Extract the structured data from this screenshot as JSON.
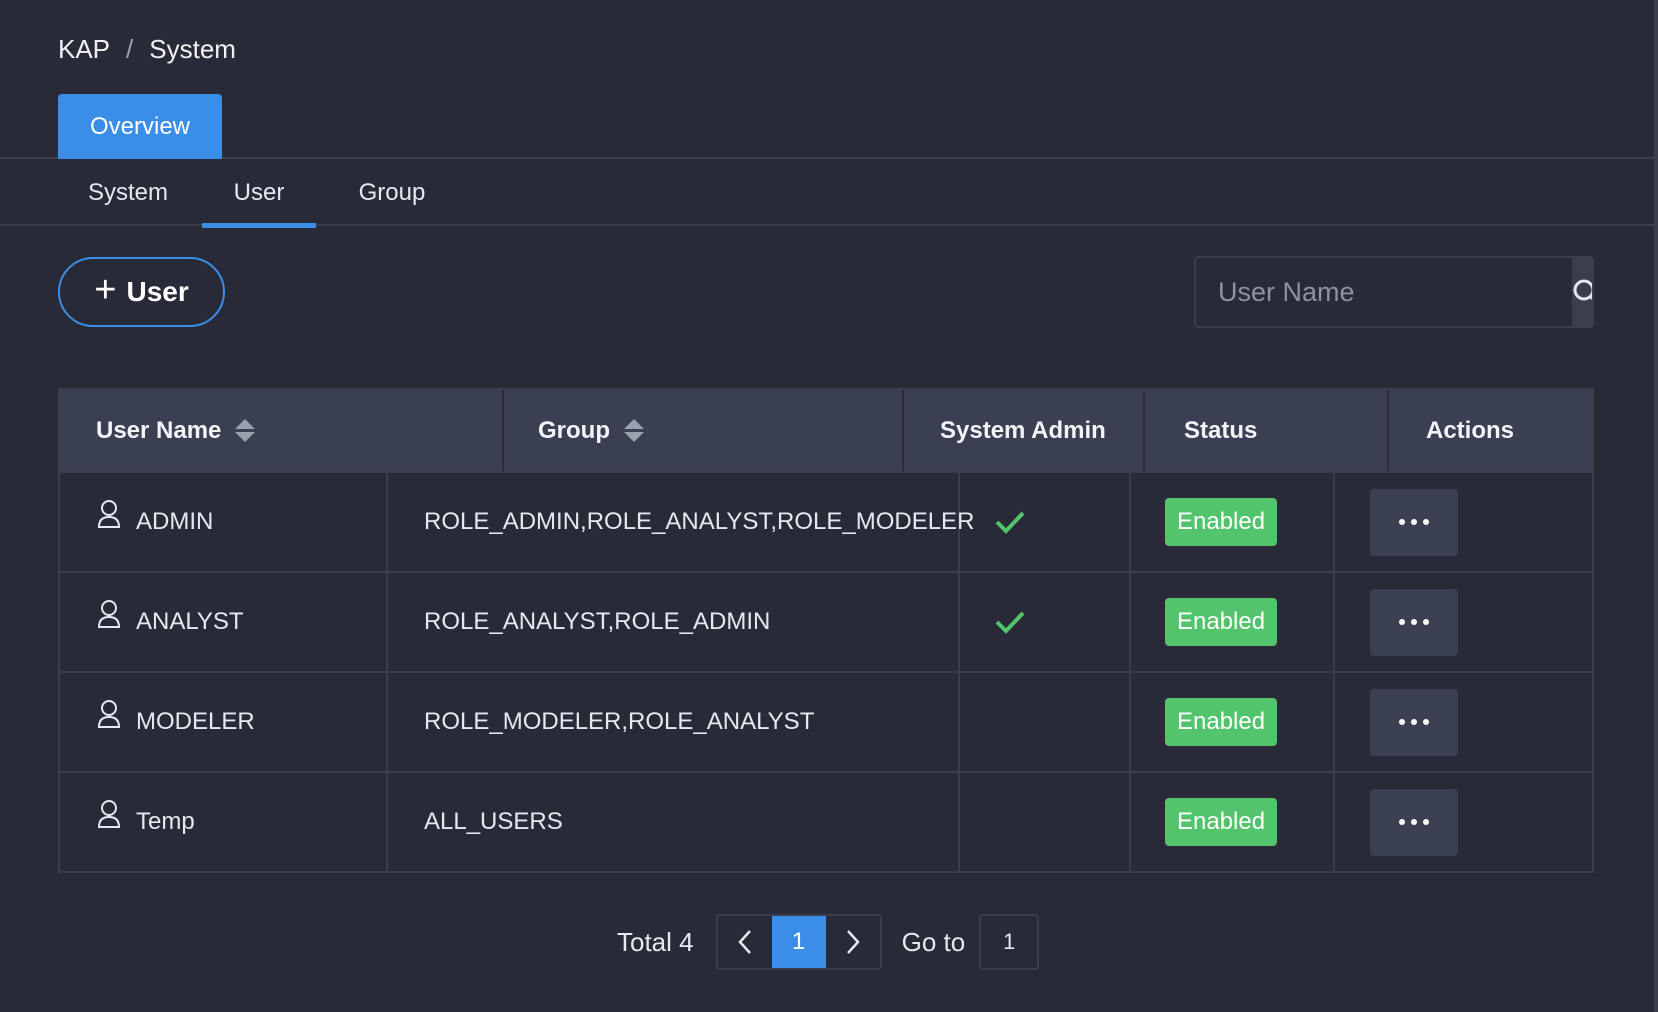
{
  "breadcrumb": {
    "root": "KAP",
    "separator": "/",
    "current": "System"
  },
  "top_tabs": {
    "active": "Overview"
  },
  "sub_tabs": [
    {
      "label": "System"
    },
    {
      "label": "User",
      "active": true
    },
    {
      "label": "Group"
    }
  ],
  "toolbar": {
    "add_user_label": "User"
  },
  "search": {
    "placeholder": "User Name"
  },
  "table": {
    "headers": {
      "user_name": "User Name",
      "group": "Group",
      "system_admin": "System Admin",
      "status": "Status",
      "actions": "Actions"
    },
    "rows": [
      {
        "user_name": "ADMIN",
        "groups": "ROLE_ADMIN,ROLE_ANALYST,ROLE_MODELER",
        "system_admin": true,
        "status": "Enabled"
      },
      {
        "user_name": "ANALYST",
        "groups": "ROLE_ANALYST,ROLE_ADMIN",
        "system_admin": true,
        "status": "Enabled"
      },
      {
        "user_name": "MODELER",
        "groups": "ROLE_MODELER,ROLE_ANALYST",
        "system_admin": false,
        "status": "Enabled"
      },
      {
        "user_name": "Temp",
        "groups": "ALL_USERS",
        "system_admin": false,
        "status": "Enabled"
      }
    ]
  },
  "pagination": {
    "total_label": "Total 4",
    "current_page": "1",
    "goto_label": "Go to",
    "goto_value": "1"
  },
  "colors": {
    "background": "#282a37",
    "accent": "#3b8ee8",
    "status_enabled": "#52c46c",
    "check": "#52c46c"
  }
}
